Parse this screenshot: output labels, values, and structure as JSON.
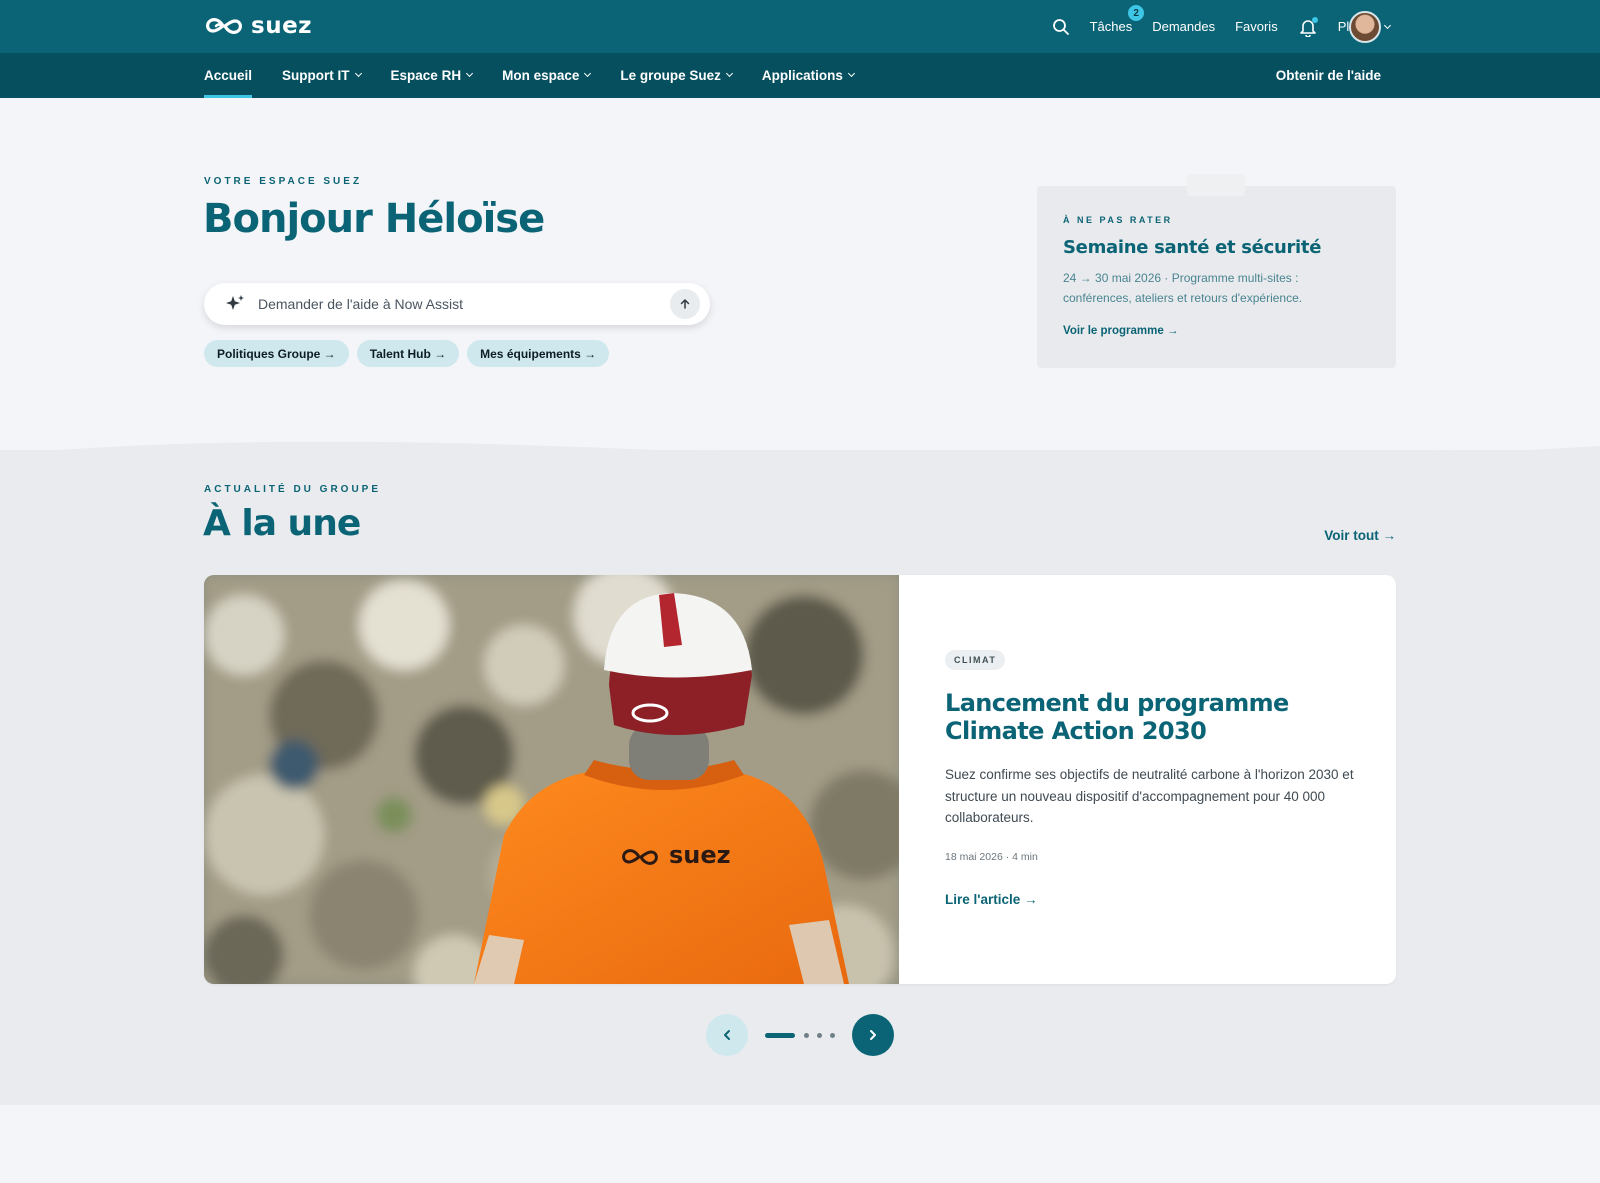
{
  "brand": {
    "logo_text": "suez",
    "primary": "#0b6475",
    "accent": "#3dc6e6"
  },
  "topbar": {
    "search_icon": "search-icon",
    "tasks_label": "Tâches",
    "tasks_badge": "2",
    "requests_label": "Demandes",
    "favorites_label": "Favoris",
    "notifications_icon": "bell-icon",
    "more_label": "Plus"
  },
  "nav": {
    "items": [
      {
        "label": "Accueil"
      },
      {
        "label": "Support IT"
      },
      {
        "label": "Espace RH"
      },
      {
        "label": "Mon espace"
      },
      {
        "label": "Le groupe Suez"
      },
      {
        "label": "Applications"
      }
    ],
    "help_label": "Obtenir de l'aide"
  },
  "hero": {
    "eyebrow": "VOTRE ESPACE SUEZ",
    "title": "Bonjour Héloïse",
    "assist_placeholder": "Demander de l'aide à Now Assist",
    "chips": [
      "Politiques Groupe →",
      "Talent Hub →",
      "Mes équipements →"
    ]
  },
  "promo": {
    "eyebrow": "À NE PAS RATER",
    "title": "Semaine santé et sécurité",
    "description": "24 → 30 mai 2026 · Programme multi-sites : conférences, ateliers et retours d'expérience.",
    "link": "Voir le programme →"
  },
  "news": {
    "eyebrow": "ACTUALITÉ DU GROUPE",
    "title": "À la une",
    "see_all": "Voir tout →",
    "article": {
      "tag": "CLIMAT",
      "title": "Lancement du programme Climate Action 2030",
      "description": "Suez confirme ses objectifs de neutralité carbone à l'horizon 2030 et structure un nouveau dispositif d'accompagnement pour 40 000 collaborateurs.",
      "meta": "18 mai 2026 · 4 min",
      "link": "Lire l'article →",
      "image_jacket_text": "suez"
    },
    "carousel": {
      "current": 1,
      "total": 4
    }
  }
}
